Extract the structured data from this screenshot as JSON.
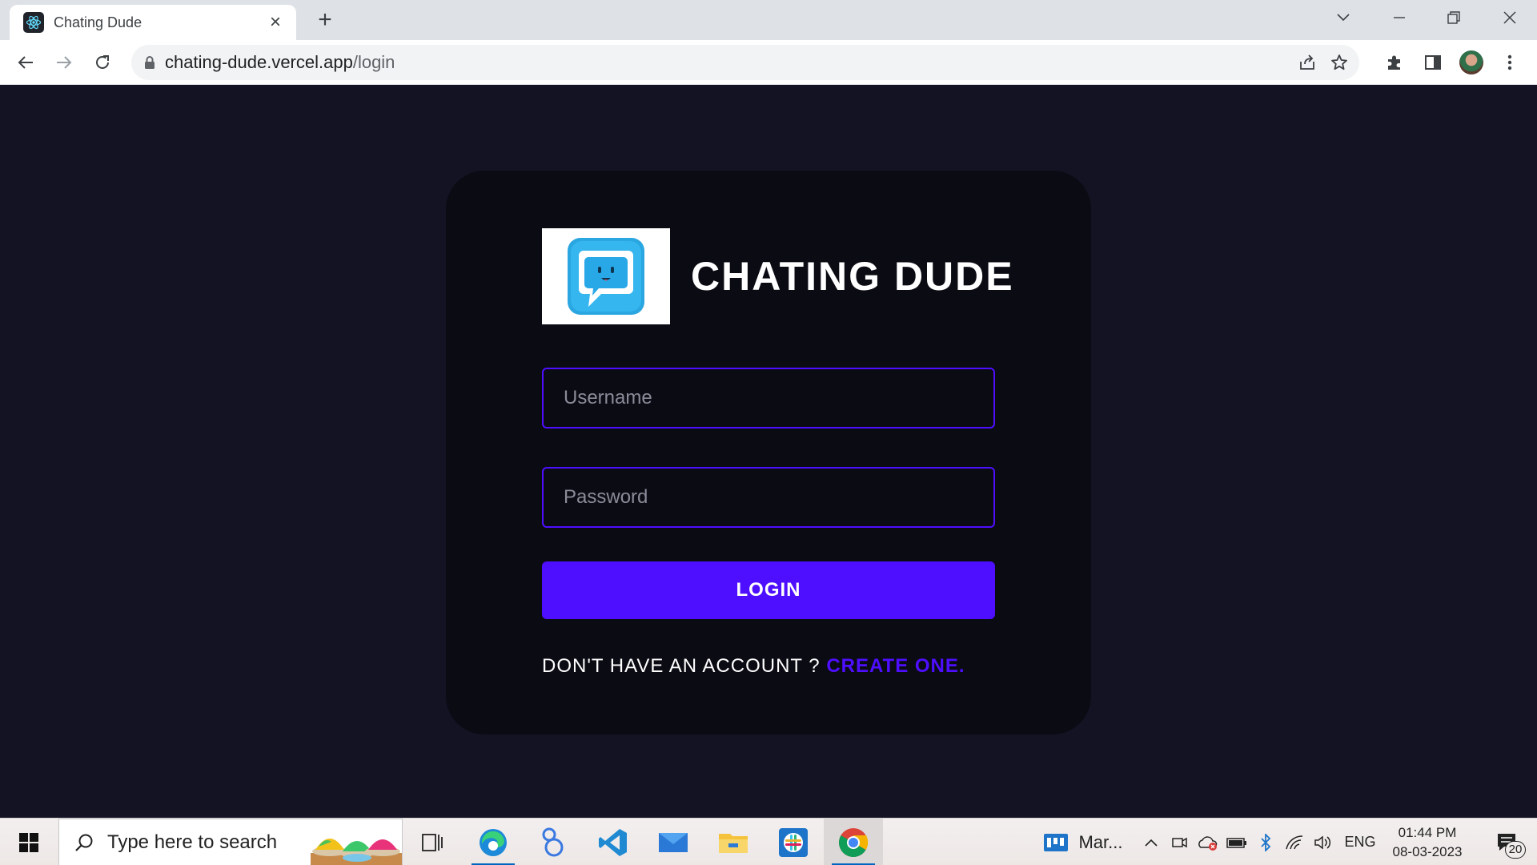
{
  "browser": {
    "tab_title": "Chating Dude",
    "url_host": "chating-dude.vercel.app",
    "url_path": "/login"
  },
  "app": {
    "title": "CHATING DUDE",
    "username_placeholder": "Username",
    "password_placeholder": "Password",
    "login_label": "LOGIN",
    "signup_prompt": "DON'T HAVE AN ACCOUNT ?",
    "signup_link": "CREATE ONE.",
    "accent_color": "#4e0eff",
    "background_color": "#131324",
    "card_color": "#0b0b14"
  },
  "taskbar": {
    "search_placeholder": "Type here to search",
    "pinned_app_label": "Mar...",
    "language": "ENG",
    "time": "01:44 PM",
    "date": "08-03-2023",
    "notification_count": "20"
  }
}
